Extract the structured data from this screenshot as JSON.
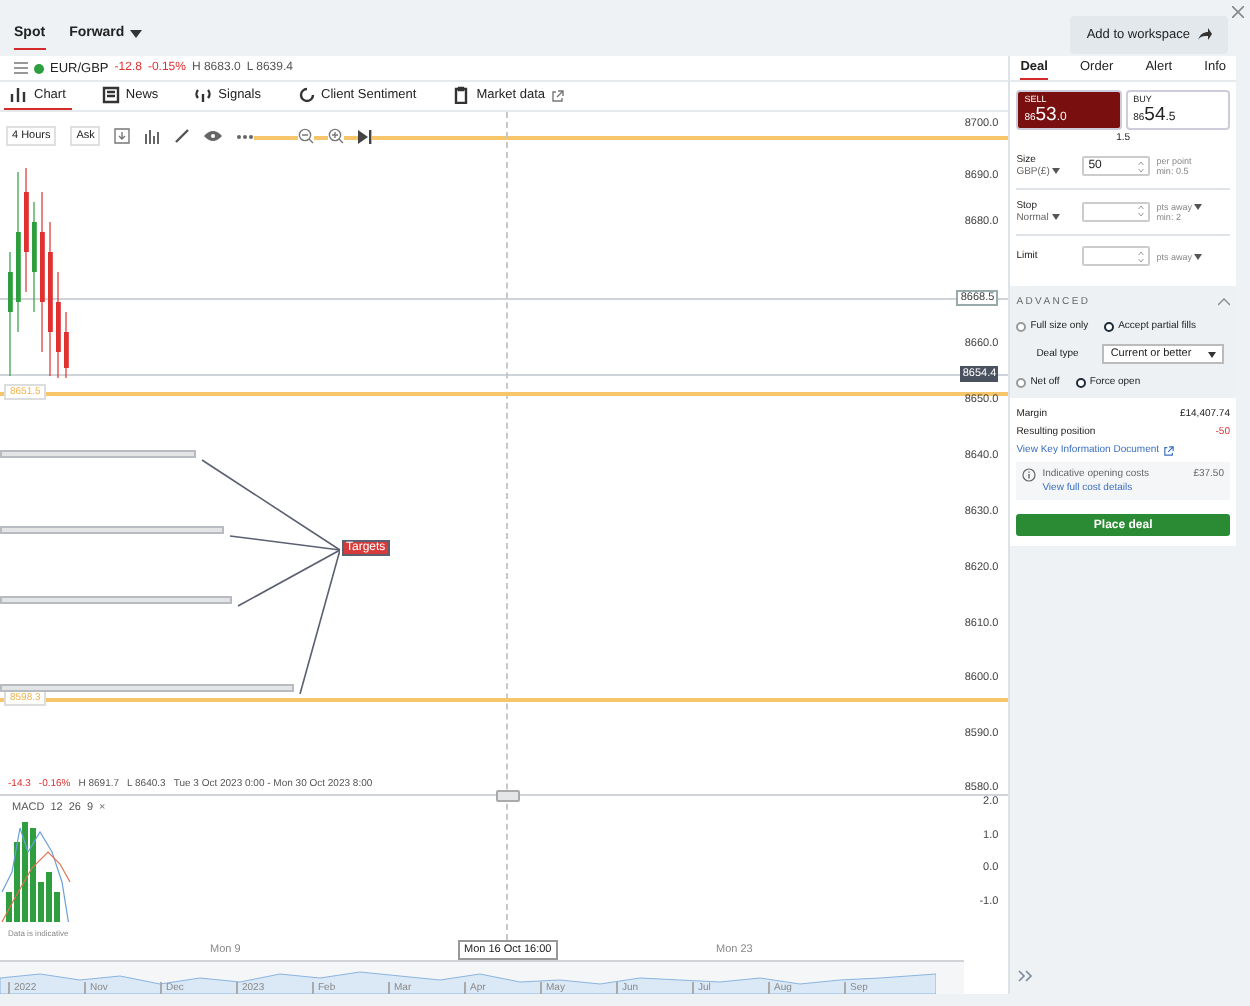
{
  "top_tabs": [
    {
      "label": "Spot",
      "selected": true,
      "has_menu": false
    },
    {
      "label": "Forward",
      "selected": false,
      "has_menu": true
    }
  ],
  "workspace_button": "Add to workspace",
  "instrument": {
    "name": "EUR/GBP",
    "change": "-12.8",
    "change_pct": "-0.15%",
    "high": "H 8683.0",
    "low": "L 8639.4"
  },
  "chart_tabs": [
    {
      "label": "Chart",
      "selected": true,
      "external": false
    },
    {
      "label": "News",
      "selected": false,
      "external": false
    },
    {
      "label": "Signals",
      "selected": false,
      "external": false
    },
    {
      "label": "Client Sentiment",
      "selected": false,
      "external": false
    },
    {
      "label": "Market data",
      "selected": false,
      "external": true
    }
  ],
  "toolbar": {
    "interval": "4 Hours",
    "price_type": "Ask"
  },
  "price_axis": [
    {
      "label": "8700.0",
      "kind": "tick"
    },
    {
      "label": "8690.0",
      "kind": "tick"
    },
    {
      "label": "8680.0",
      "kind": "tick"
    },
    {
      "label": "8668.5",
      "kind": "marker"
    },
    {
      "label": "8660.0",
      "kind": "tick"
    },
    {
      "label": "8654.4",
      "kind": "current"
    },
    {
      "label": "8650.0",
      "kind": "tick"
    },
    {
      "label": "8640.0",
      "kind": "tick"
    },
    {
      "label": "8630.0",
      "kind": "tick"
    },
    {
      "label": "8620.0",
      "kind": "tick"
    },
    {
      "label": "8610.0",
      "kind": "tick"
    },
    {
      "label": "8600.0",
      "kind": "tick"
    },
    {
      "label": "8590.0",
      "kind": "tick"
    },
    {
      "label": "8580.0",
      "kind": "tick"
    }
  ],
  "levels": [
    {
      "label": "8651.5"
    },
    {
      "label": "8598.3"
    }
  ],
  "annotation": {
    "label": "Targets"
  },
  "stats": {
    "change": "-14.3",
    "change_pct": "-0.16%",
    "high": "H 8691.7",
    "low": "L 8640.3",
    "range": "Tue 3 Oct 2023 0:00 - Mon 30 Oct 2023 8:00"
  },
  "macd": {
    "label": "MACD",
    "params": [
      "12",
      "26",
      "9"
    ],
    "close": "×",
    "axis": [
      "2.0",
      "1.0",
      "0.0",
      "-1.0"
    ],
    "note": "Data is indicative"
  },
  "time_axis": [
    "Mon 9",
    "Mon 23"
  ],
  "crosshair_time": "Mon 16 Oct 16:00",
  "navigator": [
    "2022",
    "Nov",
    "Dec",
    "2023",
    "Feb",
    "Mar",
    "Apr",
    "May",
    "Jun",
    "Jul",
    "Aug",
    "Sep"
  ],
  "deal_tabs": [
    {
      "label": "Deal",
      "selected": true
    },
    {
      "label": "Order",
      "selected": false
    },
    {
      "label": "Alert",
      "selected": false
    },
    {
      "label": "Info",
      "selected": false
    }
  ],
  "quotes": [
    {
      "label": "SELL",
      "prefix": "86",
      "big": "53",
      "small": ".0",
      "selected": true
    },
    {
      "label": "BUY",
      "prefix": "86",
      "big": "54",
      "small": ".5",
      "selected": false
    }
  ],
  "spread": "1.5",
  "size": {
    "label": "Size",
    "unit": "GBP(£)",
    "value": "50",
    "hint": "per point",
    "min": "min: 0.5"
  },
  "stop": {
    "label": "Stop",
    "type": "Normal",
    "suffix": "pts away",
    "min": "min: 2"
  },
  "limit": {
    "label": "Limit",
    "suffix": "pts away"
  },
  "advanced": {
    "title": "ADVANCED",
    "expanded": true,
    "fill_options": [
      {
        "label": "Full size only",
        "selected": false
      },
      {
        "label": "Accept partial fills",
        "selected": true
      }
    ],
    "deal_type_label": "Deal type",
    "deal_type": "Current or better",
    "open_options": [
      {
        "label": "Net off",
        "selected": false
      },
      {
        "label": "Force open",
        "selected": true
      }
    ]
  },
  "margin": {
    "label": "Margin",
    "value": "£14,407.74"
  },
  "position": {
    "label": "Resulting position",
    "value": "-50"
  },
  "kid_link": "View Key Information Document",
  "costs": {
    "label": "Indicative opening costs",
    "value": "£37.50",
    "link": "View full cost details"
  },
  "place_button": "Place deal"
}
